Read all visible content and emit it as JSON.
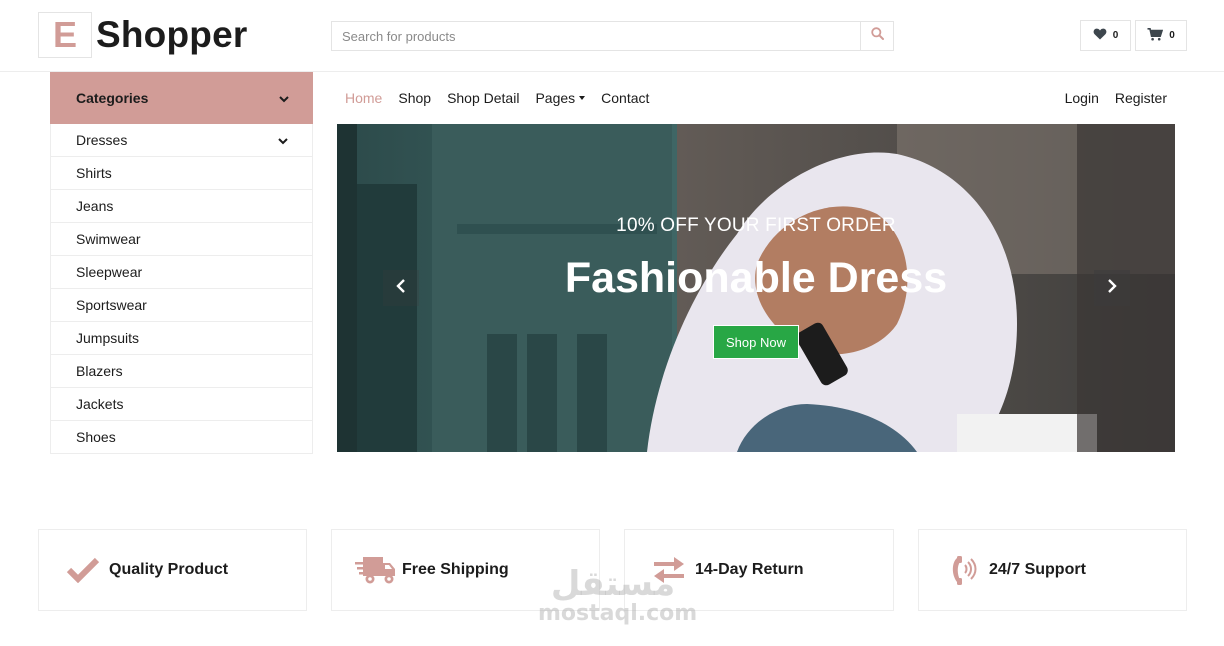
{
  "brand": {
    "logo_letter": "E",
    "name": "Shopper",
    "accent": "#d19c97"
  },
  "search": {
    "placeholder": "Search for products",
    "value": "",
    "icon": "search-icon"
  },
  "header_actions": {
    "wishlist": {
      "icon": "heart-icon",
      "count": "0"
    },
    "cart": {
      "icon": "cart-icon",
      "count": "0"
    }
  },
  "sidebar": {
    "title": "Categories",
    "items": [
      {
        "label": "Dresses",
        "has_submenu": true
      },
      {
        "label": "Shirts"
      },
      {
        "label": "Jeans"
      },
      {
        "label": "Swimwear"
      },
      {
        "label": "Sleepwear"
      },
      {
        "label": "Sportswear"
      },
      {
        "label": "Jumpsuits"
      },
      {
        "label": "Blazers"
      },
      {
        "label": "Jackets"
      },
      {
        "label": "Shoes"
      }
    ]
  },
  "nav": {
    "links": [
      {
        "label": "Home",
        "active": true
      },
      {
        "label": "Shop"
      },
      {
        "label": "Shop Detail"
      },
      {
        "label": "Pages",
        "dropdown": true
      },
      {
        "label": "Contact"
      }
    ],
    "right": [
      {
        "label": "Login"
      },
      {
        "label": "Register"
      }
    ]
  },
  "hero": {
    "subtitle": "10% OFF YOUR FIRST ORDER",
    "title": "Fashionable Dress",
    "button": "Shop Now",
    "button_color": "#28a745"
  },
  "features": [
    {
      "icon": "check-icon",
      "label": "Quality Product"
    },
    {
      "icon": "truck-icon",
      "label": "Free Shipping"
    },
    {
      "icon": "exchange-icon",
      "label": "14-Day Return"
    },
    {
      "icon": "phone-volume-icon",
      "label": "24/7 Support"
    }
  ],
  "watermark": {
    "arabic": "مستقل",
    "latin": "mostaql.com"
  }
}
